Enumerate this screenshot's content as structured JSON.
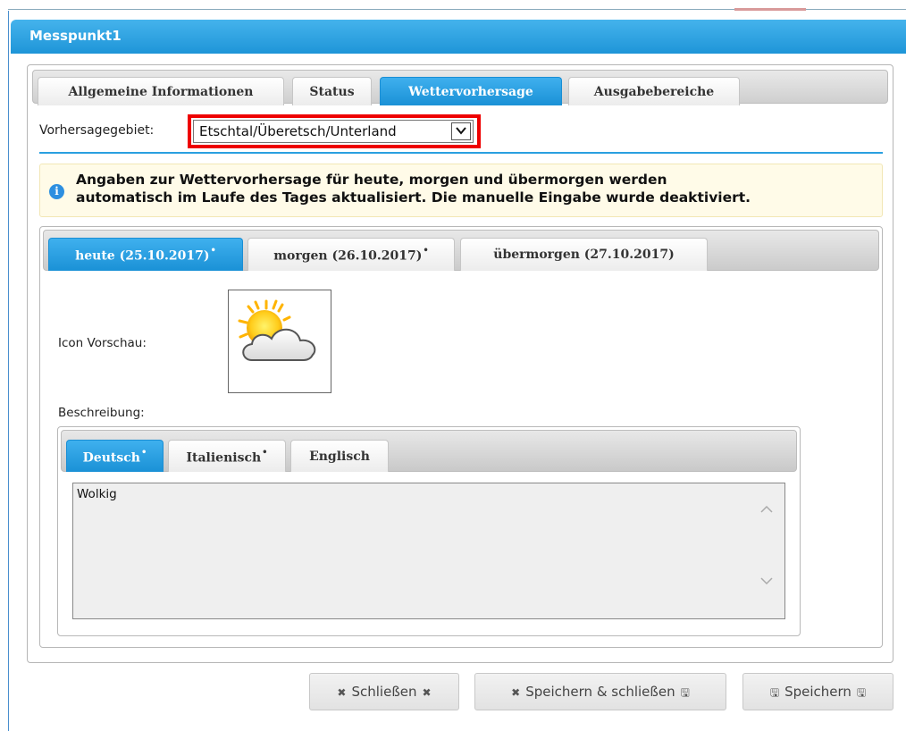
{
  "dialog": {
    "title": "Messpunkt1"
  },
  "tabs": [
    {
      "label": "Allgemeine Informationen",
      "active": false
    },
    {
      "label": "Status",
      "active": false
    },
    {
      "label": "Wettervorhersage",
      "active": true
    },
    {
      "label": "Ausgabebereiche",
      "active": false
    }
  ],
  "forecast_area": {
    "label": "Vorhersagegebiet:",
    "selected": "Etschtal/Überetsch/Unterland"
  },
  "info": {
    "text_line1": "Angaben zur Wettervorhersage für heute, morgen und übermorgen werden",
    "text_line2": "automatisch im Laufe des Tages aktualisiert. Die manuelle Eingabe wurde deaktiviert."
  },
  "day_tabs": [
    {
      "label": "heute (25.10.2017)",
      "marker": "•",
      "active": true
    },
    {
      "label": "morgen (26.10.2017)",
      "marker": "•",
      "active": false
    },
    {
      "label": "übermorgen (27.10.2017)",
      "marker": "",
      "active": false
    }
  ],
  "icon_preview": {
    "label": "Icon Vorschau:",
    "icon": "sun-behind-cloud-icon"
  },
  "description": {
    "label": "Beschreibung:",
    "value": "Wolkig"
  },
  "language_tabs": [
    {
      "label": "Deutsch",
      "marker": "•",
      "active": true
    },
    {
      "label": "Italienisch",
      "marker": "•",
      "active": false
    },
    {
      "label": "Englisch",
      "marker": "",
      "active": false
    }
  ],
  "buttons": {
    "close": "Schließen",
    "save_close": "Speichern & schließen",
    "save": "Speichern"
  },
  "colors": {
    "accent_blue": "#1e95d8",
    "highlight_red": "#ee0000",
    "info_bg": "#fffbe8"
  }
}
